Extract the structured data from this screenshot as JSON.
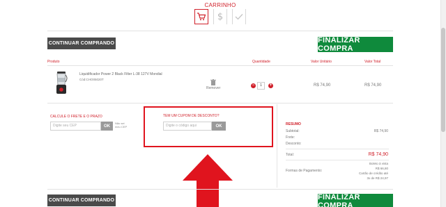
{
  "steps": {
    "title": "CARRINHO",
    "items": [
      {
        "icon": "cart-icon",
        "state": "active"
      },
      {
        "icon": "dollar-icon",
        "state": "inactive"
      },
      {
        "icon": "check-icon",
        "state": "inactive"
      }
    ]
  },
  "top_actions": {
    "continue_label": "CONTINUAR COMPRANDO",
    "checkout_label": "FINALIZAR COMPRA"
  },
  "table": {
    "headers": {
      "product": "Produto",
      "quantity": "Quantidade",
      "unit_price": "Valor Unitário",
      "total": "Valor Total"
    },
    "rows": [
      {
        "name": "Liquidificador Power 2 Black Filter L-38 127V Mondial",
        "code": "Cód:CHO05020T",
        "remove_label": "Remover",
        "quantity": "1",
        "unit_price": "R$ 74,90",
        "total": "R$ 74,90"
      }
    ]
  },
  "shipping": {
    "title": "CALCULE O FRETE E O PRAZO",
    "placeholder": "Digite seu CEP",
    "ok_label": "OK",
    "help_link": "Não sei meu CEP"
  },
  "coupon": {
    "title": "TEM UM CUPOM DE DESCONTO?",
    "placeholder": "Digite o código aqui",
    "ok_label": "OK"
  },
  "summary": {
    "title": "RESUMO",
    "subtotal_label": "Subtotal:",
    "subtotal_value": "R$ 74,90",
    "freight_label": "Frete:",
    "discount_label": "Desconto:",
    "total_label": "Total:",
    "total_value": "R$ 74,90",
    "payment_label": "Formas de Pagamento:",
    "payment_lines": [
      "Boleto à vista",
      "R$ 66,80",
      "Cartão de crédito até",
      "3x de R$ 24,97"
    ]
  },
  "bottom_actions": {
    "continue_label": "CONTINUAR COMPRANDO",
    "checkout_label": "FINALIZAR COMPRA"
  },
  "colors": {
    "accent_red": "#d0202a",
    "checkout_green": "#0f8a3c",
    "dark_button": "#4a4a4a",
    "annotation_red": "#e0141e"
  }
}
